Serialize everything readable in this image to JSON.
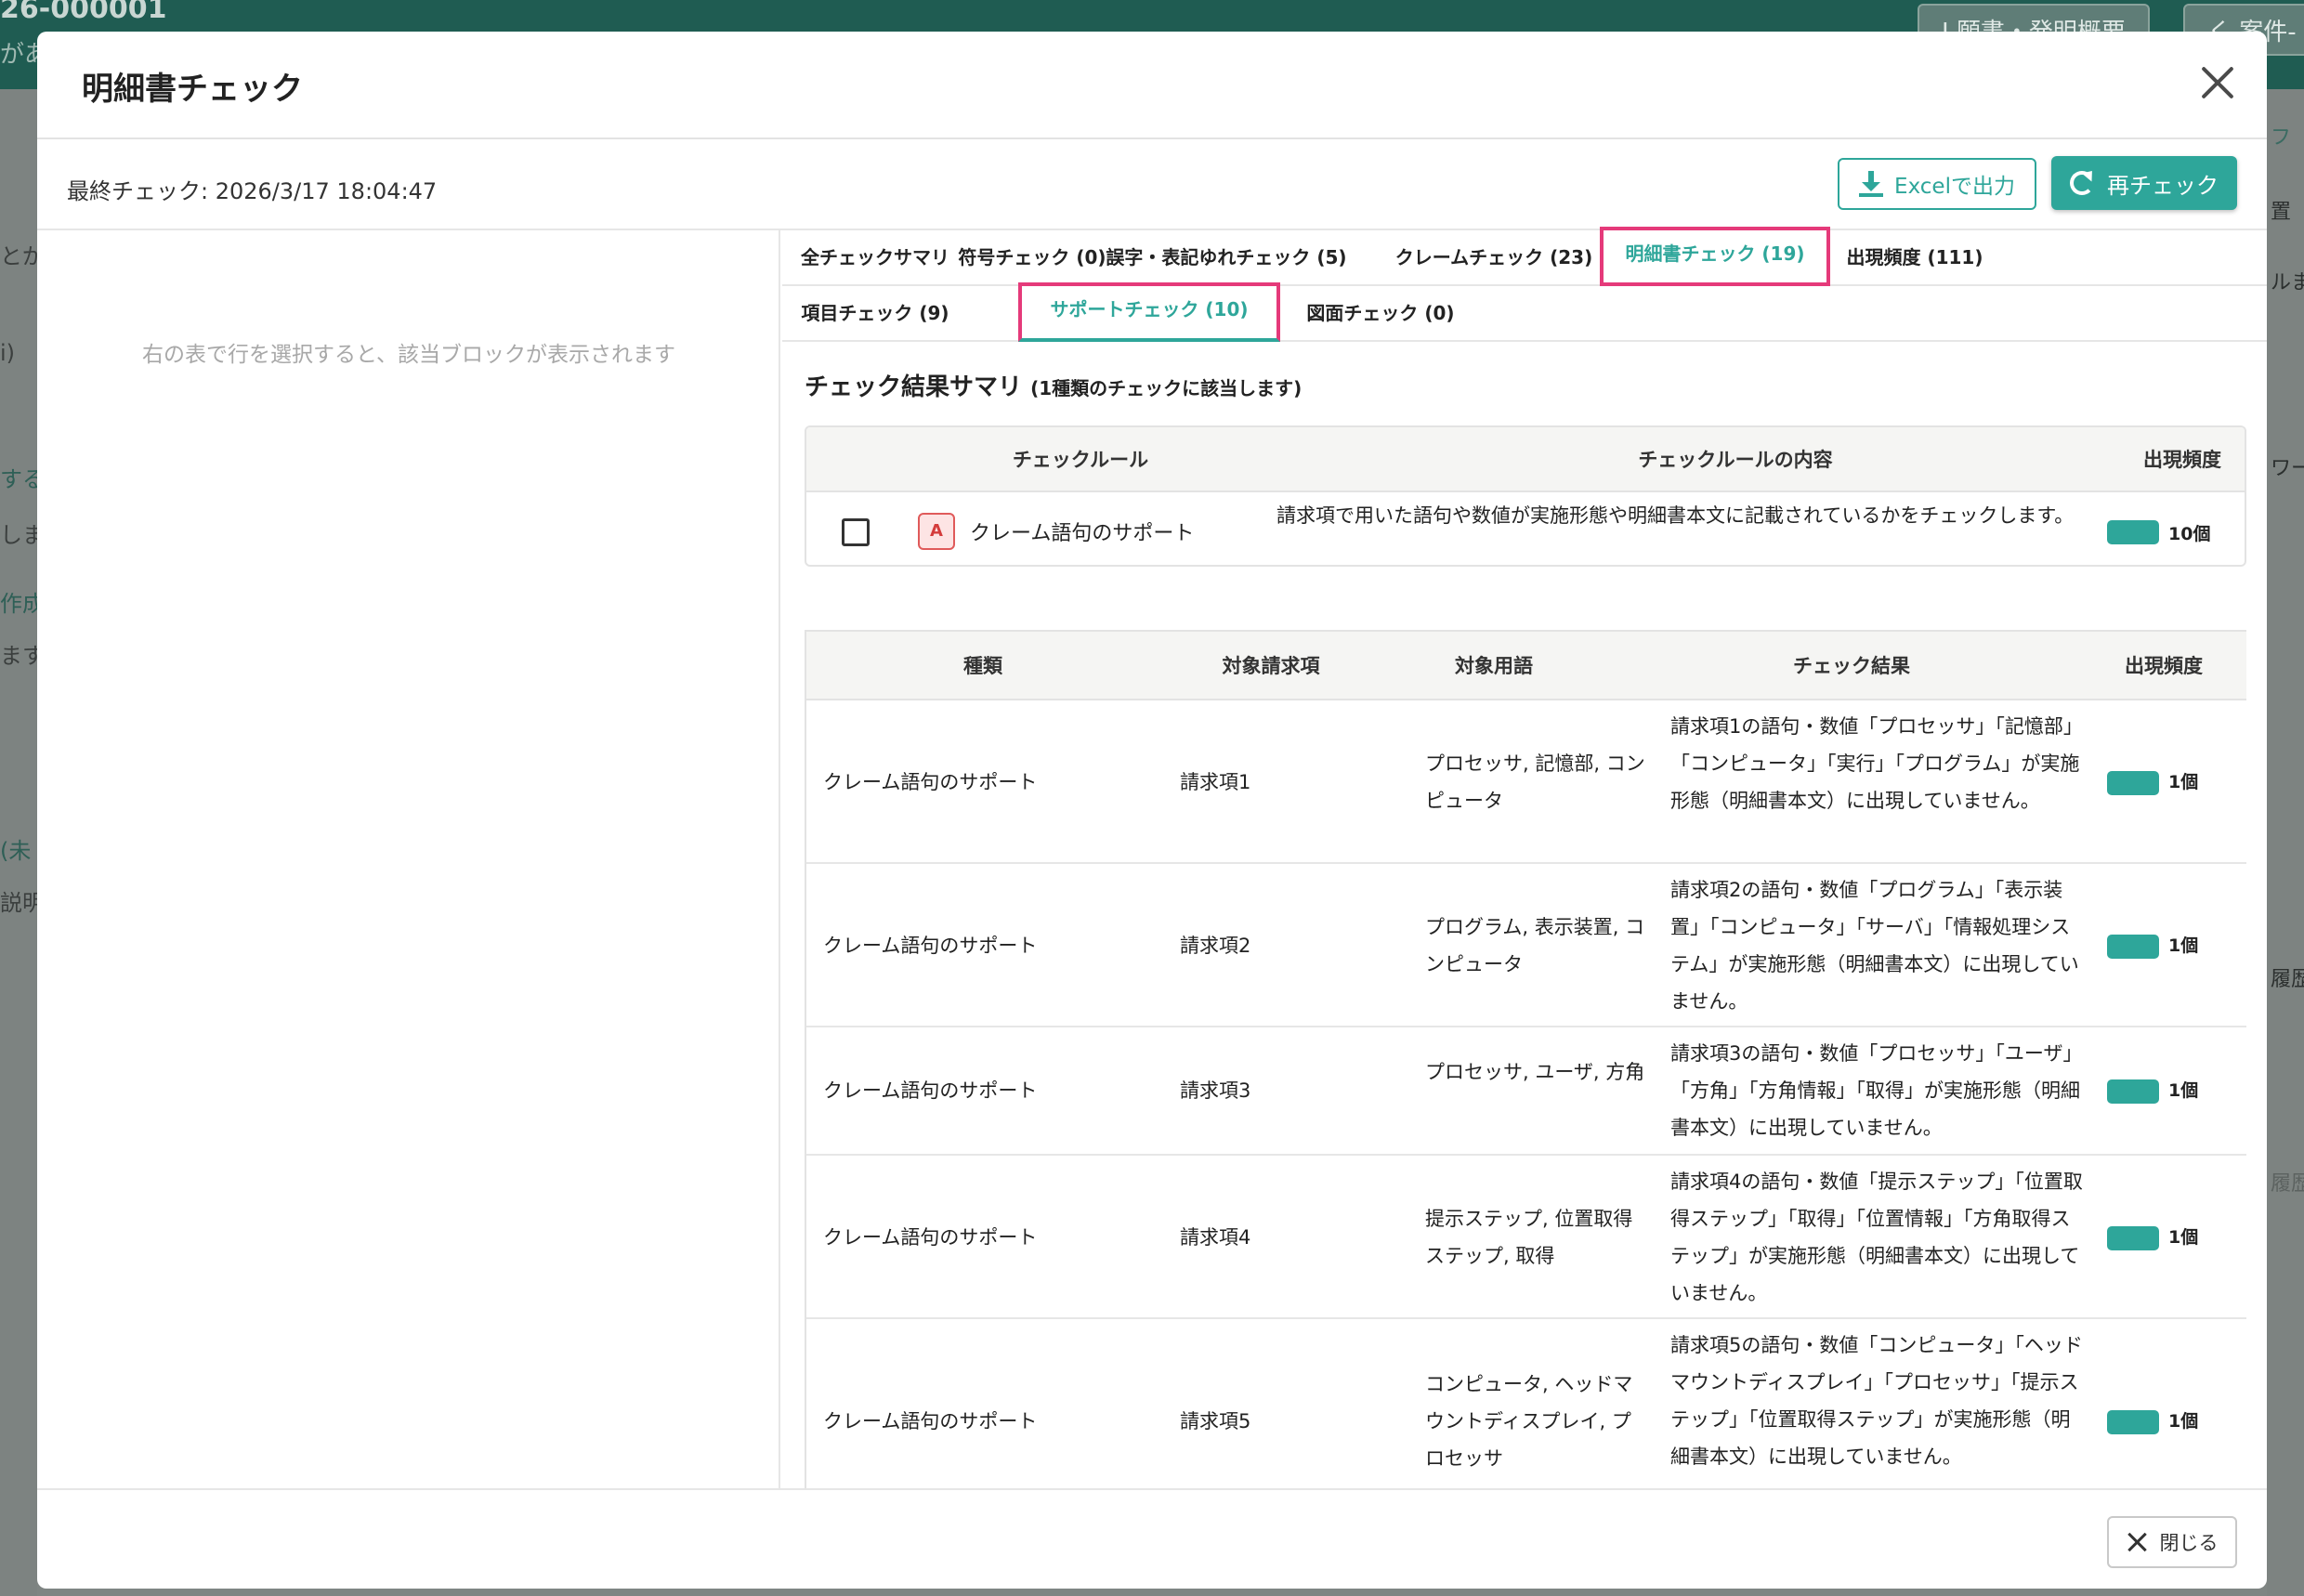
{
  "background": {
    "case_id": "26-000001",
    "partial_text": "があ",
    "buttons": [
      "I 願書・発明概要",
      "く 案件-"
    ],
    "left_fragments": [
      "とが",
      "i)",
      "する",
      "しま",
      "作成",
      "ます",
      "(未",
      "説明"
    ],
    "right_fragments": [
      "フ",
      "置",
      "ルま",
      "ワー",
      "履歴-",
      "履歴"
    ]
  },
  "modal": {
    "title": "明細書チェック",
    "last_check": "最終チェック: 2026/3/17 18:04:47",
    "excel_button": "Excelで出力",
    "recheck_button": "再チェック",
    "left_hint": "右の表で行を選択すると、該当ブロックが表示されます",
    "tabs_row1": [
      "全チェックサマリ",
      "符号チェック (0)",
      "誤字・表記ゆれチェック (5)",
      "クレームチェック (23)",
      "明細書チェック (19)",
      "出現頻度 (111)"
    ],
    "tabs_row2": [
      "項目チェック (9)",
      "サポートチェック (10)",
      "図面チェック (0)"
    ],
    "summary_title": "チェック結果サマリ",
    "summary_note": "(1種類のチェックに該当します)",
    "summary_table": {
      "headers": [
        "チェックルール",
        "チェックルールの内容",
        "出現頻度"
      ],
      "rule": {
        "badge": "A",
        "name": "クレーム語句のサポート",
        "description": "請求項で用いた語句や数値が実施形態や明細書本文に記載されているかをチェックします。",
        "frequency": "10個"
      }
    },
    "detail_table": {
      "headers": [
        "種類",
        "対象請求項",
        "対象用語",
        "チェック結果",
        "出現頻度"
      ],
      "rows": [
        {
          "type": "クレーム語句のサポート",
          "claim": "請求項1",
          "terms": "プロセッサ, 記憶部, コンピュータ",
          "result": "請求項1の語句・数値「プロセッサ」「記憶部」「コンピュータ」「実行」「プログラム」が実施形態（明細書本文）に出現していません。",
          "frequency": "1個"
        },
        {
          "type": "クレーム語句のサポート",
          "claim": "請求項2",
          "terms": "プログラム, 表示装置, コンピュータ",
          "result": "請求項2の語句・数値「プログラム」「表示装置」「コンピュータ」「サーバ」「情報処理システム」が実施形態（明細書本文）に出現していません。",
          "frequency": "1個"
        },
        {
          "type": "クレーム語句のサポート",
          "claim": "請求項3",
          "terms": "プロセッサ, ユーザ, 方角",
          "result": "請求項3の語句・数値「プロセッサ」「ユーザ」「方角」「方角情報」「取得」が実施形態（明細書本文）に出現していません。",
          "frequency": "1個"
        },
        {
          "type": "クレーム語句のサポート",
          "claim": "請求項4",
          "terms": "提示ステップ, 位置取得ステップ, 取得",
          "result": "請求項4の語句・数値「提示ステップ」「位置取得ステップ」「取得」「位置情報」「方角取得ステップ」が実施形態（明細書本文）に出現していません。",
          "frequency": "1個"
        },
        {
          "type": "クレーム語句のサポート",
          "claim": "請求項5",
          "terms": "コンピュータ, ヘッドマウントディスプレイ, プロセッサ",
          "result": "請求項5の語句・数値「コンピュータ」「ヘッドマウントディスプレイ」「プロセッサ」「提示ステップ」「位置取得ステップ」が実施形態（明細書本文）に出現していません。",
          "frequency": "1個"
        }
      ]
    },
    "close_button": "閉じる"
  },
  "colors": {
    "accent": "#2ea69a",
    "highlight": "#e53a7a",
    "badge_red": "#d43c3c",
    "header_bg": "#f5f5f3"
  }
}
